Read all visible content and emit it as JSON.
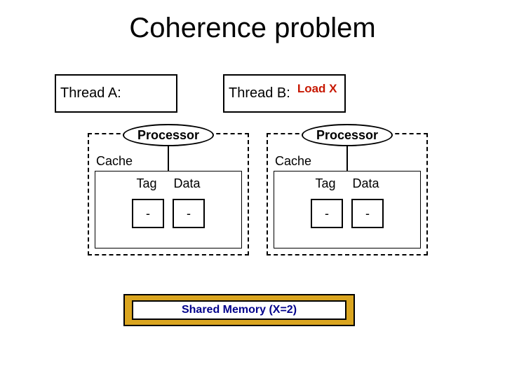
{
  "title": "Coherence problem",
  "threadA": {
    "label": "Thread A:",
    "load": ""
  },
  "threadB": {
    "label": "Thread B:",
    "load": "Load X"
  },
  "processor_label": "Processor",
  "cache_label": "Cache",
  "columns": {
    "tag": "Tag",
    "data": "Data"
  },
  "procA": {
    "tag": "-",
    "data": "-"
  },
  "procB": {
    "tag": "-",
    "data": "-"
  },
  "memory": "Shared Memory (X=2)"
}
